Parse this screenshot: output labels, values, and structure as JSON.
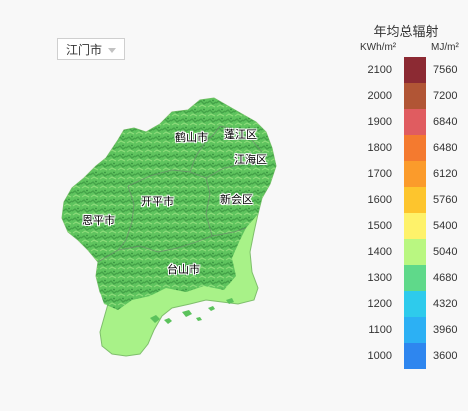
{
  "selector": {
    "value": "江门市"
  },
  "map": {
    "regions": [
      {
        "id": "heshan",
        "name": "鹤山市"
      },
      {
        "id": "pengjiang",
        "name": "蓬江区"
      },
      {
        "id": "jianghai",
        "name": "江海区"
      },
      {
        "id": "kaiping",
        "name": "开平市"
      },
      {
        "id": "xinhui",
        "name": "新会区"
      },
      {
        "id": "enping",
        "name": "恩平市"
      },
      {
        "id": "taishan",
        "name": "台山市"
      }
    ]
  },
  "legend": {
    "title": "年均总辐射",
    "unit_left": "KWh/m²",
    "unit_right": "MJ/m²",
    "classes": [
      {
        "kwh": "2100",
        "mj": "7560",
        "color": "#8c2a33"
      },
      {
        "kwh": "2000",
        "mj": "7200",
        "color": "#b15535"
      },
      {
        "kwh": "1900",
        "mj": "6840",
        "color": "#e05c60"
      },
      {
        "kwh": "1800",
        "mj": "6480",
        "color": "#f47a2f"
      },
      {
        "kwh": "1700",
        "mj": "6120",
        "color": "#fb9b2b"
      },
      {
        "kwh": "1600",
        "mj": "5760",
        "color": "#fdc52d"
      },
      {
        "kwh": "1500",
        "mj": "5400",
        "color": "#fef26a"
      },
      {
        "kwh": "1400",
        "mj": "5040",
        "color": "#b9f781"
      },
      {
        "kwh": "1300",
        "mj": "4680",
        "color": "#5fd98a"
      },
      {
        "kwh": "1200",
        "mj": "4320",
        "color": "#2ecbec"
      },
      {
        "kwh": "1100",
        "mj": "3960",
        "color": "#2cb0f4"
      },
      {
        "kwh": "1000",
        "mj": "3600",
        "color": "#2e86ef"
      }
    ]
  }
}
